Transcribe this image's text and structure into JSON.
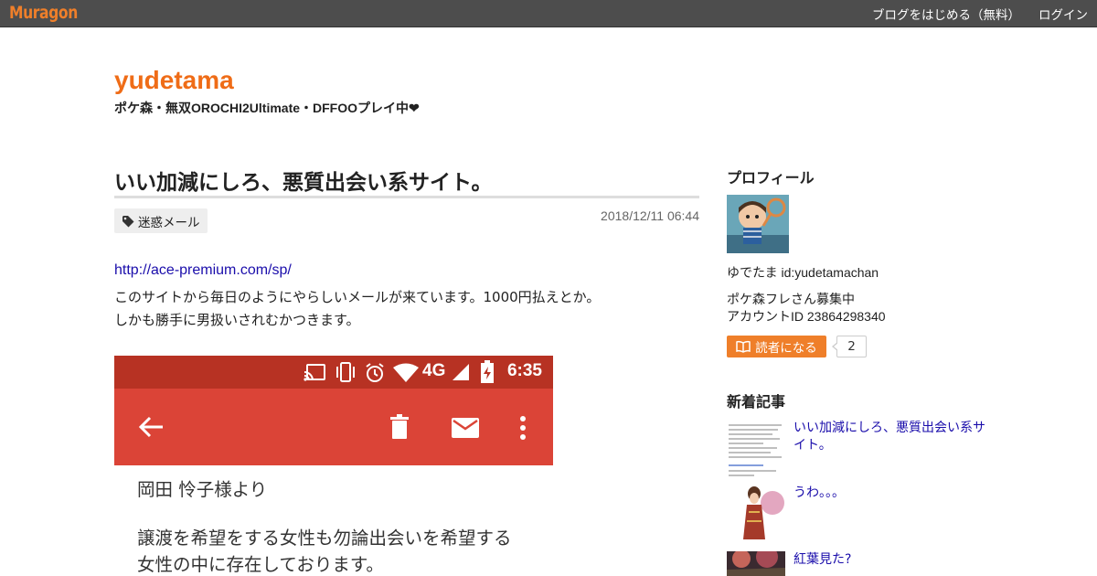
{
  "topbar": {
    "logo": "Muragon",
    "links": [
      "ブログをはじめる（無料）",
      "ログイン"
    ]
  },
  "blog": {
    "title": "yudetama",
    "subtitle": "ポケ森・無双OROCHI2Ultimate・DFFOOプレイ中❤"
  },
  "article": {
    "title": "いい加減にしろ、悪質出会い系サイト。",
    "tag": "迷惑メール",
    "date": "2018/12/11 06:44",
    "link": "http://ace-premium.com/sp/",
    "lines": [
      "このサイトから毎日のようにやらしいメールが来ています。1000円払えとか。",
      "しかも勝手に男扱いされむかつきます。"
    ],
    "screenshot": {
      "status_network": "4G",
      "status_time": "6:35",
      "lines": [
        "岡田 怜子様より",
        "譲渡を希望をする女性も勿論出会いを希望する",
        "女性の中に存在しております。"
      ]
    }
  },
  "sidebar": {
    "profile_heading": "プロフィール",
    "name_line": "ゆでたま  id:yudetamachan",
    "bio_lines": [
      "ポケ森フレさん募集中",
      "アカウントID 23864298340"
    ],
    "reader_button": "読者になる",
    "reader_count": "2",
    "recent_heading": "新着記事",
    "recent": [
      {
        "title": "いい加減にしろ、悪質出会い系サイト。"
      },
      {
        "title": "うわ。。。"
      },
      {
        "title": "紅葉見た?"
      }
    ]
  },
  "colors": {
    "accent": "#ef6c17",
    "topbar": "#4d4d4d",
    "link": "#1a0dab",
    "button": "#ef7f2a"
  }
}
